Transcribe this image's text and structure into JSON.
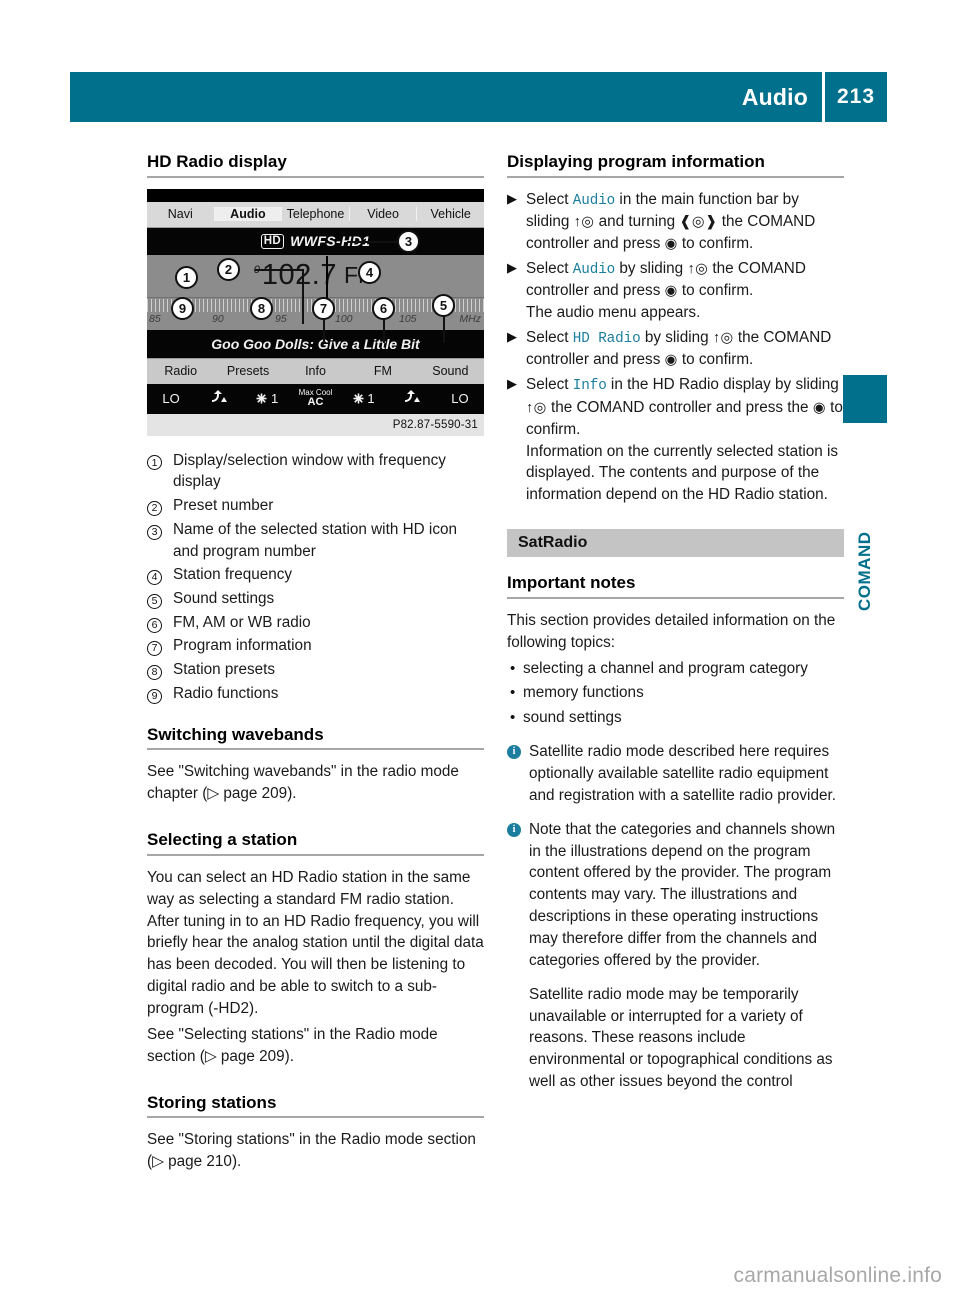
{
  "header": {
    "title": "Audio",
    "page_number": "213"
  },
  "thumb_index": {
    "label": "COMAND"
  },
  "watermark": "carmanualsonline.info",
  "left_column": {
    "section_title": "HD Radio display",
    "comand_screen": {
      "main_menu": [
        {
          "label": "Navi",
          "selected": false
        },
        {
          "label": "Audio",
          "selected": true
        },
        {
          "label": "Telephone",
          "selected": false
        },
        {
          "label": "Video",
          "selected": false
        },
        {
          "label": "Vehicle",
          "selected": false
        }
      ],
      "hd_badge": "HD",
      "station_name": "WWFS-HD1",
      "preset_number": "0",
      "frequency": "102.7",
      "frequency_unit": "FM",
      "scale_labels": [
        "85",
        "90",
        "95",
        "100",
        "105",
        "MHz"
      ],
      "now_playing": "Goo Goo Dolls: Give a Little Bit",
      "soft_keys": [
        "Radio",
        "Presets",
        "Info",
        "FM",
        "Sound"
      ],
      "climate_bar": {
        "left_temp": "LO",
        "left_airflow": "airflow-icon",
        "left_fan": "1",
        "center_small": "Max Cool",
        "center_big": "AC",
        "right_fan": "1",
        "right_airflow": "airflow-icon",
        "right_temp": "LO"
      },
      "caption": "P82.87-5590-31",
      "callouts": [
        "1",
        "2",
        "3",
        "4",
        "5",
        "6",
        "7",
        "8",
        "9"
      ]
    },
    "legend": [
      {
        "num": "1",
        "text": "Display/selection window with frequency display"
      },
      {
        "num": "2",
        "text": "Preset number"
      },
      {
        "num": "3",
        "text": "Name of the selected station with HD icon and program number"
      },
      {
        "num": "4",
        "text": "Station frequency"
      },
      {
        "num": "5",
        "text": "Sound settings"
      },
      {
        "num": "6",
        "text": "FM, AM or WB radio"
      },
      {
        "num": "7",
        "text": "Program information"
      },
      {
        "num": "8",
        "text": "Station presets"
      },
      {
        "num": "9",
        "text": "Radio functions"
      }
    ],
    "switching_wavebands": {
      "title": "Switching wavebands",
      "body_pre": "See \"Switching wavebands\" in the radio mode chapter (",
      "ref_arrow": "▷",
      "ref_text": " page 209",
      "body_post": ")."
    },
    "selecting_a_station": {
      "title": "Selecting a station",
      "para1": "You can select an HD Radio station in the same way as selecting a standard FM radio station. After tuning in to an HD Radio frequency, you will briefly hear the analog station until the digital data has been decoded. You will then be listening to digital radio and be able to switch to a sub-program (-HD2).",
      "para2_pre": "See \"Selecting stations\" in the Radio mode section (",
      "ref_arrow": "▷",
      "ref_text": " page 209",
      "para2_post": ")."
    },
    "storing_stations": {
      "title": "Storing stations",
      "body_pre": "See \"Storing stations\" in the Radio mode section (",
      "ref_arrow": "▷",
      "ref_text": " page 210",
      "body_post": ")."
    }
  },
  "right_column": {
    "section_title": "Displaying program information",
    "steps": [
      {
        "marker": "▶",
        "parts": [
          {
            "type": "text",
            "value": "Select "
          },
          {
            "type": "kw",
            "value": "Audio"
          },
          {
            "type": "text",
            "value": " in the main function bar by sliding "
          },
          {
            "type": "ctl",
            "value": "↑◎"
          },
          {
            "type": "text",
            "value": " and turning "
          },
          {
            "type": "ctl",
            "value": "❰◎❱"
          },
          {
            "type": "text",
            "value": " the COMAND controller and press "
          },
          {
            "type": "ctl",
            "value": "◉"
          },
          {
            "type": "text",
            "value": " to confirm."
          }
        ]
      },
      {
        "marker": "▶",
        "parts": [
          {
            "type": "text",
            "value": "Select "
          },
          {
            "type": "kw",
            "value": "Audio"
          },
          {
            "type": "text",
            "value": " by sliding "
          },
          {
            "type": "ctl",
            "value": "↑◎"
          },
          {
            "type": "text",
            "value": " the COMAND controller and press "
          },
          {
            "type": "ctl",
            "value": "◉"
          },
          {
            "type": "text",
            "value": " to confirm."
          },
          {
            "type": "break",
            "value": ""
          },
          {
            "type": "text",
            "value": "The audio menu appears."
          }
        ]
      },
      {
        "marker": "▶",
        "parts": [
          {
            "type": "text",
            "value": "Select "
          },
          {
            "type": "kw",
            "value": "HD Radio"
          },
          {
            "type": "text",
            "value": " by sliding "
          },
          {
            "type": "ctl",
            "value": "↑◎"
          },
          {
            "type": "text",
            "value": " the COMAND controller and press "
          },
          {
            "type": "ctl",
            "value": "◉"
          },
          {
            "type": "text",
            "value": " to confirm."
          }
        ]
      },
      {
        "marker": "▶",
        "parts": [
          {
            "type": "text",
            "value": "Select "
          },
          {
            "type": "kw",
            "value": "Info"
          },
          {
            "type": "text",
            "value": " in the HD Radio display by sliding "
          },
          {
            "type": "ctl",
            "value": "↑◎"
          },
          {
            "type": "text",
            "value": " the COMAND controller and press the "
          },
          {
            "type": "ctl",
            "value": "◉"
          },
          {
            "type": "text",
            "value": " to confirm."
          },
          {
            "type": "break",
            "value": ""
          },
          {
            "type": "text",
            "value": "Information on the currently selected station is displayed. The contents and purpose of the information depend on the HD Radio station."
          }
        ]
      }
    ],
    "satradio": {
      "band_title": "SatRadio",
      "important_notes_title": "Important notes",
      "intro": "This section provides detailed information on the following topics:",
      "bullets": [
        "selecting a channel and program category",
        "memory functions",
        "sound settings"
      ],
      "notes": [
        {
          "icon": "info-icon",
          "text": "Satellite radio mode described here requires optionally available satellite radio equipment and registration with a satellite radio provider."
        },
        {
          "icon": "info-icon",
          "text": "Note that the categories and channels shown in the illustrations depend on the program content offered by the provider. The program contents may vary. The illustrations and descriptions in these operating instructions may therefore differ from the channels and categories offered by the provider."
        }
      ],
      "closing_para": "Satellite radio mode may be temporarily unavailable or interrupted for a variety of reasons. These reasons include environmental or topographical conditions as well as other issues beyond the control"
    }
  },
  "colors": {
    "brand_teal": "#00708c",
    "keyword_teal": "#1b7e9e",
    "band_gray": "#c4c4c4",
    "rule_gray": "#a6a6a6"
  }
}
